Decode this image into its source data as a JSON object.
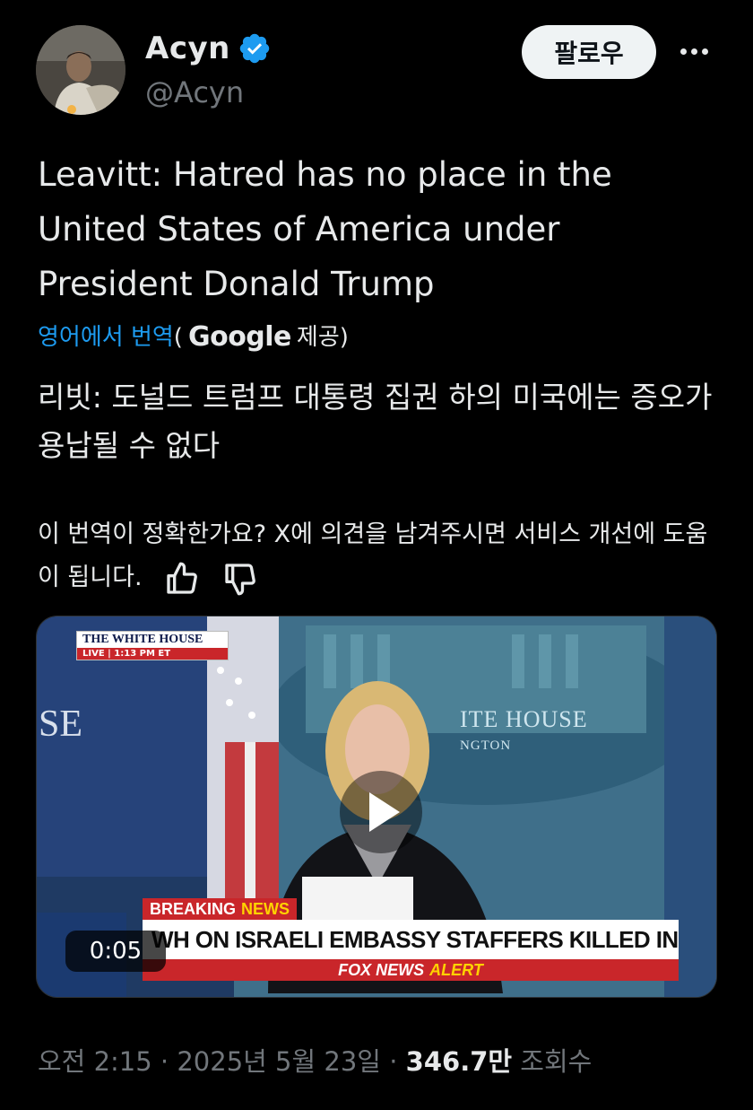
{
  "author": {
    "name": "Acyn",
    "handle": "@Acyn",
    "follow_label": "팔로우"
  },
  "tweet": {
    "text": "Leavitt: Hatred has no place in the United States of America under President Donald Trump"
  },
  "translation": {
    "link_label": "영어에서 번역",
    "provider_prefix": "(",
    "provider": "Google",
    "provider_suffix": "제공)",
    "text": "리빗: 도널드 트럼프 대통령 집권 하의 미국에는 증오가 용납될 수 없다",
    "feedback_prompt": "이 번역이 정확한가요? X에 의견을 남겨주시면 서비스 개선에 도움이 됩니다."
  },
  "video": {
    "duration": "0:05",
    "wh_title": "THE WHITE HOUSE",
    "live_label": "LIVE",
    "live_time": "1:13 PM ET",
    "backdrop_text": "ITE HOUSE",
    "backdrop_sub": "NGTON",
    "left_backdrop_text": "SE",
    "breaking_label": "BREAKING",
    "breaking_news": "NEWS",
    "headline": "WH ON ISRAELI EMBASSY STAFFERS KILLED IN DC",
    "alert_brand": "FOX NEWS",
    "alert_word": "ALERT",
    "channel_label": "channel"
  },
  "meta": {
    "time": "오전 2:15",
    "sep1": " · ",
    "date": "2025년 5월 23일",
    "sep2": " · ",
    "views": "346.7만",
    "views_label": "조회수"
  },
  "colors": {
    "accent": "#1d9bf0",
    "verified": "#1d9bf0",
    "muted": "#71767b",
    "breaking_red": "#c9262a",
    "alert_yellow": "#ffd200"
  },
  "icons": {
    "verified": "verified-badge-icon",
    "more": "more-dots-icon",
    "thumbs_up": "thumbs-up-icon",
    "thumbs_down": "thumbs-down-icon",
    "play": "play-icon"
  }
}
